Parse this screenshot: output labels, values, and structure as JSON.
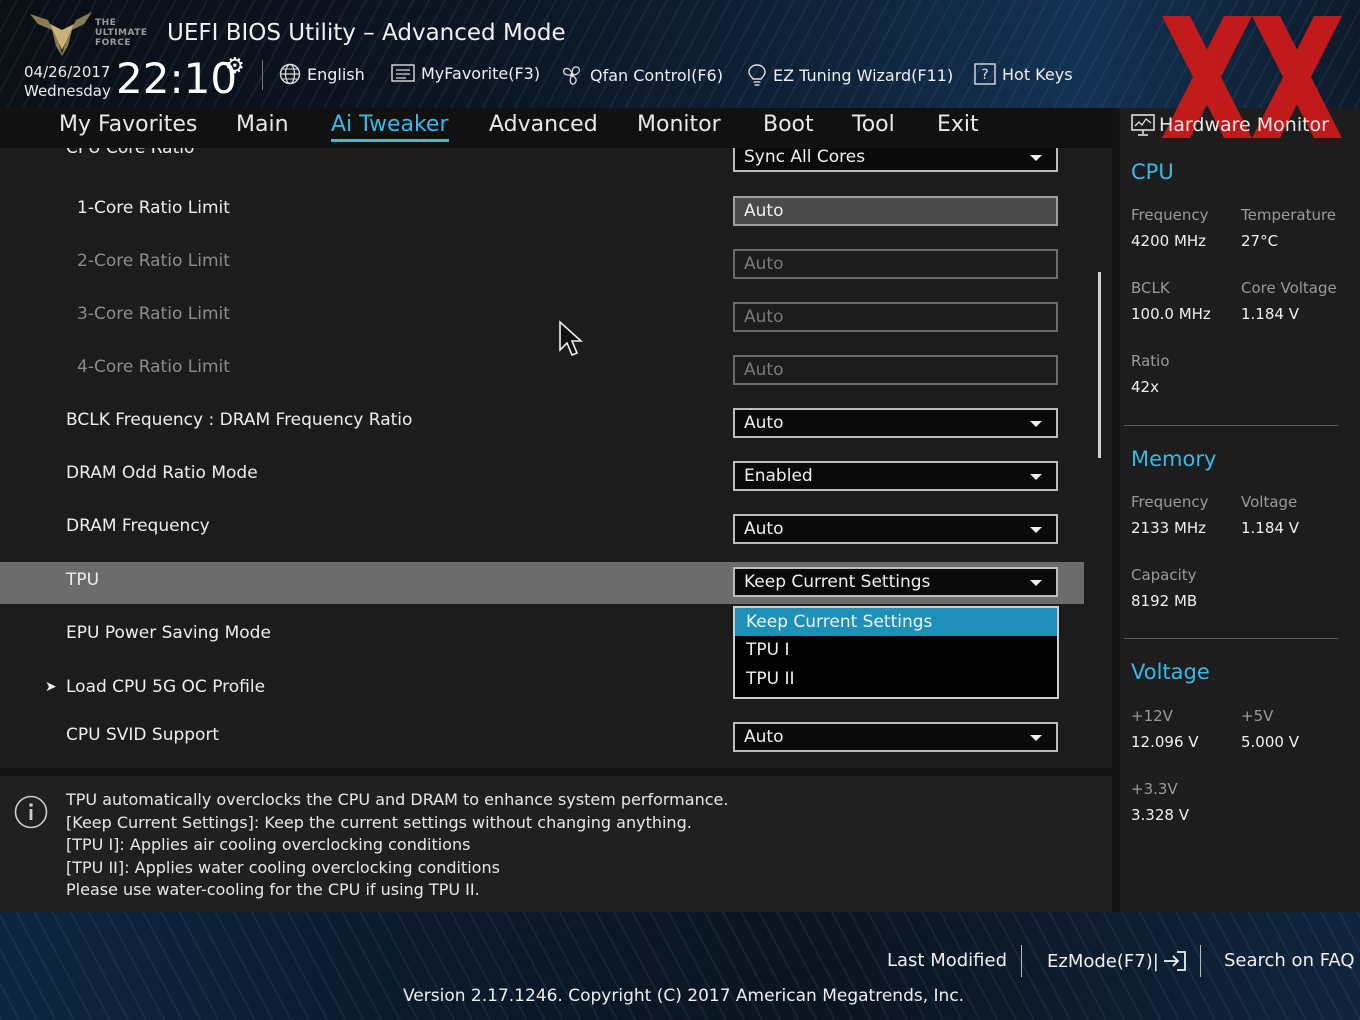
{
  "header": {
    "logo_text_lines": [
      "THE",
      "ULTIMATE",
      "FORCE"
    ],
    "title": "UEFI BIOS Utility – Advanced Mode",
    "date": "04/26/2017",
    "day": "Wednesday",
    "time": "22:10",
    "tools": {
      "language": "English",
      "myfavorite": "MyFavorite(F3)",
      "qfan": "Qfan Control(F6)",
      "ez_tuning": "EZ Tuning Wizard(F11)",
      "hotkeys": "Hot Keys"
    },
    "watermark_color": "#d11a1a"
  },
  "tabs": [
    {
      "label": "My Favorites"
    },
    {
      "label": "Main"
    },
    {
      "label": "Ai Tweaker",
      "active": true
    },
    {
      "label": "Advanced"
    },
    {
      "label": "Monitor"
    },
    {
      "label": "Boot"
    },
    {
      "label": "Tool"
    },
    {
      "label": "Exit"
    }
  ],
  "settings": {
    "cpu_core_ratio": {
      "label": "CPU Core Ratio",
      "value": "Sync All Cores"
    },
    "core1": {
      "label": "1-Core Ratio Limit",
      "value": "Auto"
    },
    "core2": {
      "label": "2-Core Ratio Limit",
      "value": "Auto"
    },
    "core3": {
      "label": "3-Core Ratio Limit",
      "value": "Auto"
    },
    "core4": {
      "label": "4-Core Ratio Limit",
      "value": "Auto"
    },
    "bclk_dram": {
      "label": "BCLK Frequency : DRAM Frequency Ratio",
      "value": "Auto"
    },
    "dram_odd": {
      "label": "DRAM Odd Ratio Mode",
      "value": "Enabled"
    },
    "dram_freq": {
      "label": "DRAM Frequency",
      "value": "Auto"
    },
    "tpu": {
      "label": "TPU",
      "value": "Keep Current Settings"
    },
    "epu": {
      "label": "EPU Power Saving Mode"
    },
    "load_5g": {
      "label": "Load CPU 5G OC Profile"
    },
    "svid": {
      "label": "CPU SVID Support",
      "value": "Auto"
    }
  },
  "tpu_dropdown": {
    "options": [
      "Keep Current Settings",
      "TPU I",
      "TPU II"
    ],
    "selected": "Keep Current Settings"
  },
  "help": {
    "lines": [
      "TPU automatically overclocks the CPU and DRAM to enhance system performance.",
      "[Keep Current Settings]: Keep the current settings without changing anything.",
      "[TPU I]: Applies air cooling overclocking conditions",
      "[TPU II]: Applies water cooling overclocking conditions",
      "Please use water-cooling for the CPU if using TPU II."
    ]
  },
  "hardware_monitor": {
    "title": "Hardware Monitor",
    "cpu": {
      "section": "CPU",
      "frequency_label": "Frequency",
      "frequency": "4200 MHz",
      "temperature_label": "Temperature",
      "temperature": "27°C",
      "bclk_label": "BCLK",
      "bclk": "100.0 MHz",
      "core_voltage_label": "Core Voltage",
      "core_voltage": "1.184 V",
      "ratio_label": "Ratio",
      "ratio": "42x"
    },
    "memory": {
      "section": "Memory",
      "frequency_label": "Frequency",
      "frequency": "2133 MHz",
      "voltage_label": "Voltage",
      "voltage": "1.184 V",
      "capacity_label": "Capacity",
      "capacity": "8192 MB"
    },
    "voltage": {
      "section": "Voltage",
      "v12_label": "+12V",
      "v12": "12.096 V",
      "v5_label": "+5V",
      "v5": "5.000 V",
      "v33_label": "+3.3V",
      "v33": "3.328 V"
    }
  },
  "footer": {
    "last_modified": "Last Modified",
    "ezmode": "EzMode(F7)|",
    "search_faq": "Search on FAQ",
    "version": "Version 2.17.1246. Copyright (C) 2017 American Megatrends, Inc."
  },
  "colors": {
    "accent": "#3ab8e8",
    "dropdown_selected": "#1e90b8",
    "highlight_row": "#6c6c6c"
  }
}
